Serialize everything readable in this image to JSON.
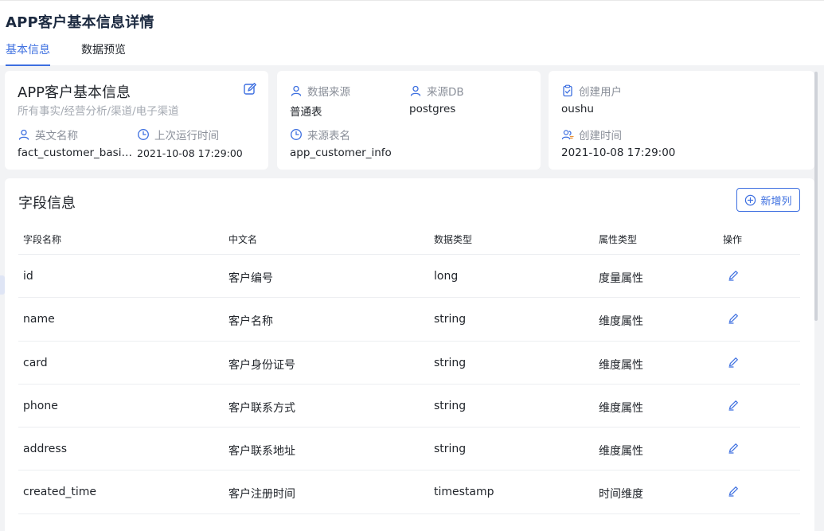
{
  "page": {
    "title": "APP客户基本信息详情"
  },
  "tabs": [
    {
      "label": "基本信息",
      "active": true
    },
    {
      "label": "数据预览",
      "active": false
    }
  ],
  "info_card": {
    "title": "APP客户基本信息",
    "path": "所有事实/经营分析/渠道/电子渠道",
    "english_name_label": "英文名称",
    "english_name_value": "fact_customer_basic...",
    "last_run_label": "上次运行时间",
    "last_run_value": "2021-10-08 17:29:00"
  },
  "source_card": {
    "data_source_label": "数据来源",
    "data_source_value": "普通表",
    "source_db_label": "来源DB",
    "source_db_value": "postgres",
    "source_table_label": "来源表名",
    "source_table_value": "app_customer_info"
  },
  "creator_card": {
    "creator_label": "创建用户",
    "creator_value": "oushu",
    "created_time_label": "创建时间",
    "created_time_value": "2021-10-08 17:29:00"
  },
  "fields": {
    "title": "字段信息",
    "add_button_label": "新增列",
    "columns": [
      "字段名称",
      "中文名",
      "数据类型",
      "属性类型",
      "操作"
    ],
    "rows": [
      {
        "name": "id",
        "cn_name": "客户编号",
        "data_type": "long",
        "attr_type": "度量属性"
      },
      {
        "name": "name",
        "cn_name": "客户名称",
        "data_type": "string",
        "attr_type": "维度属性"
      },
      {
        "name": "card",
        "cn_name": "客户身份证号",
        "data_type": "string",
        "attr_type": "维度属性"
      },
      {
        "name": "phone",
        "cn_name": "客户联系方式",
        "data_type": "string",
        "attr_type": "维度属性"
      },
      {
        "name": "address",
        "cn_name": "客户联系地址",
        "data_type": "string",
        "attr_type": "维度属性"
      },
      {
        "name": "created_time",
        "cn_name": "客户注册时间",
        "data_type": "timestamp",
        "attr_type": "时间维度"
      }
    ]
  },
  "colors": {
    "accent": "#3d6fe0",
    "title": "#1c2a40",
    "muted": "#8a8f99",
    "background": "#f2f3f5"
  },
  "icons": {
    "edit": "edit-square-icon",
    "user": "user-icon",
    "clock": "clock-icon",
    "clipboard": "clipboard-icon",
    "users": "users-icon",
    "add": "plus-circle-icon",
    "row_edit": "pencil-icon"
  }
}
